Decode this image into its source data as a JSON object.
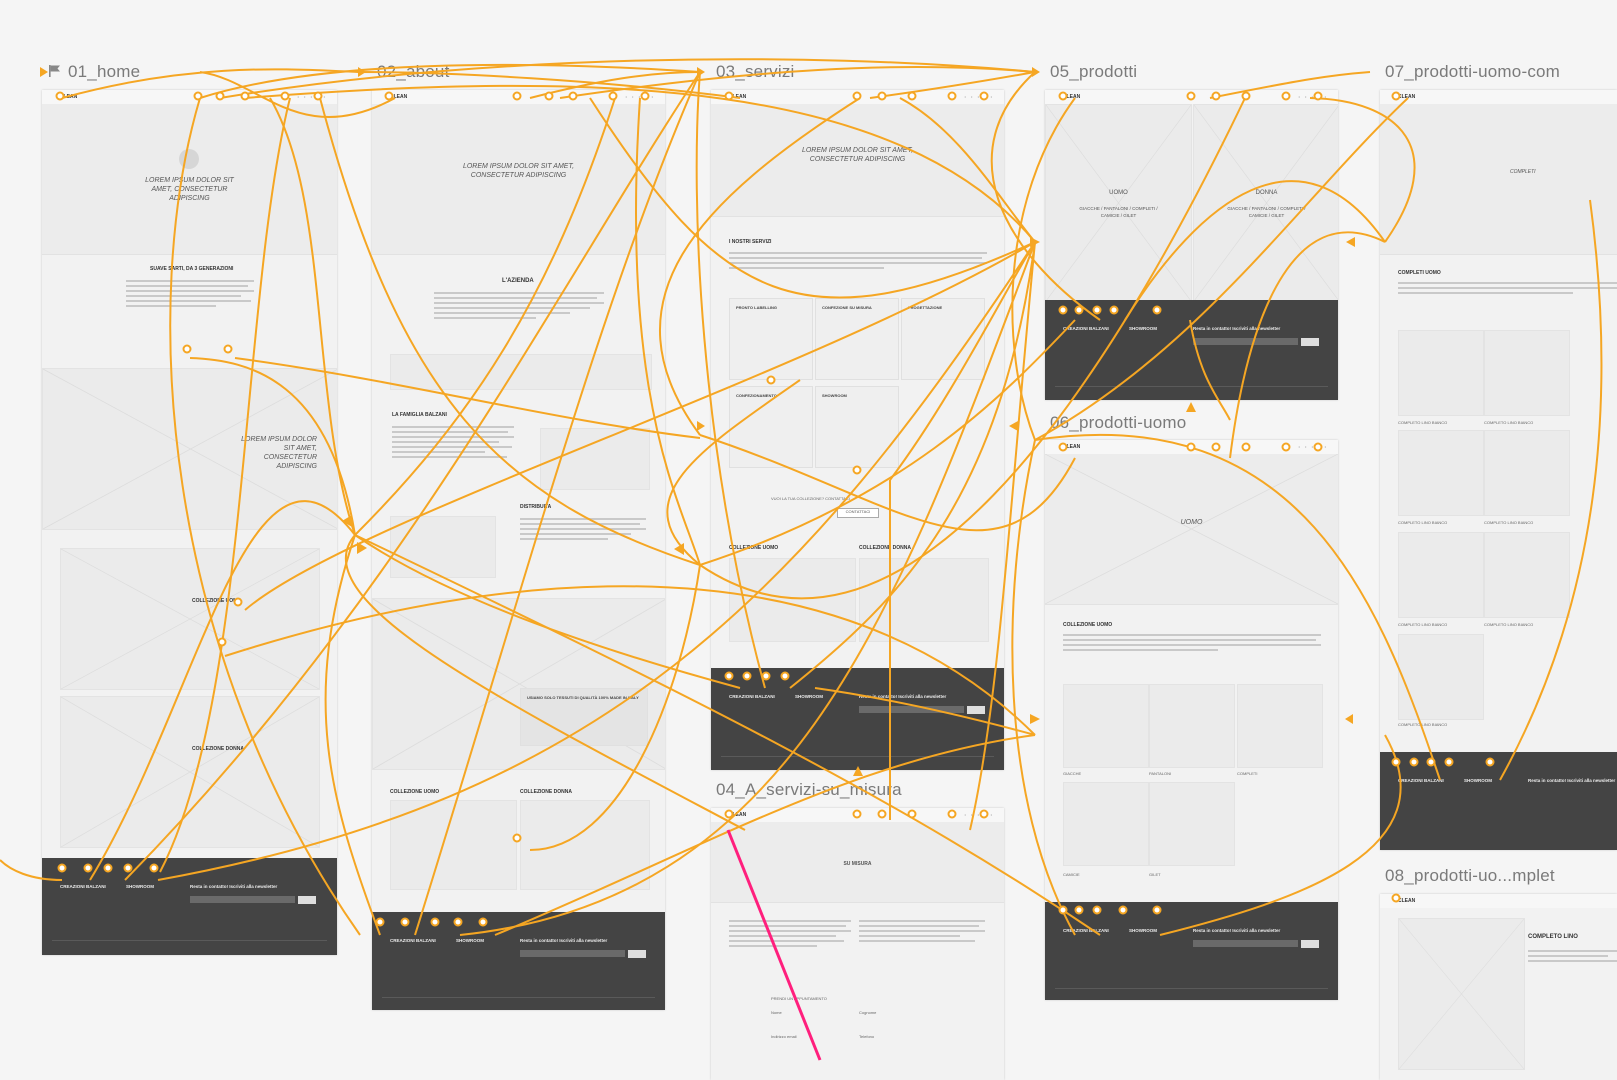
{
  "artboards": [
    {
      "id": "home",
      "title": "01_home",
      "flag": true
    },
    {
      "id": "about",
      "title": "02_about"
    },
    {
      "id": "servizi",
      "title": "03_servizi"
    },
    {
      "id": "prodotti",
      "title": "05_prodotti"
    },
    {
      "id": "prodotti_uomo_cut",
      "title": "07_prodotti-uomo-com"
    },
    {
      "id": "prodotti_uomo",
      "title": "06_prodotti-uomo"
    },
    {
      "id": "servizi_misura",
      "title": "04_A_servizi-su_misura"
    },
    {
      "id": "prodotti_completi",
      "title": "08_prodotti-uo...mplet"
    }
  ],
  "common": {
    "logo": "CLEAN",
    "lorem_hero": "LOREM IPSUM DOLOR SIT AMET, CONSECTETUR ADIPISCING",
    "lorem_hero_2": "LOREM IPSUM DOLOR SIT AMET, CONSECTETUR ADIPISCING",
    "footer": {
      "col1": "CREAZIONI BALZANI",
      "col2": "SHOWROOM",
      "col3": "Resta in contatto! Iscriviti alla newsletter"
    }
  },
  "home": {
    "section1_title": "SUAVE SARTI, DA 3 GENERAZIONI",
    "collezione_uomo": "COLLEZIONE UOMO",
    "collezione_donna": "COLLEZIONE DONNA"
  },
  "about": {
    "azienda": "L'AZIENDA",
    "famiglia": "LA FAMIGLIA BALZANI",
    "distribuita": "DISTRIBUITA",
    "tessuti": "USIAMO SOLO TESSUTI DI QUALITÀ 100% MADE IN ITALY",
    "collezione_uomo": "COLLEZIONE UOMO",
    "collezione_donna": "COLLEZIONE DONNA"
  },
  "servizi": {
    "nostri_servizi": "I NOSTRI SERVIZI",
    "cards": [
      "PRONTO LABELLING",
      "CONFEZIONE SU MISURA",
      "PROGETTAZIONE",
      "CONFEZIONAMENTO",
      "SHOWROOM"
    ],
    "cta_text": "VUOI LA TUA COLLEZIONE? CONTATTACI",
    "cta_button": "CONTATTACI",
    "collezione_uomo": "COLLEZIONE UOMO",
    "collezione_donna": "COLLEZIONE DONNA"
  },
  "prodotti": {
    "uomo": "UOMO",
    "uomo_sub": "GIACCHE / PANTALONI / COMPLETI / CAMICIE / GILET",
    "donna": "DONNA",
    "donna_sub": "GIACCHE / PANTALONI / COMPLETI / CAMICIE / GILET"
  },
  "prodotti_uomo": {
    "hero": "UOMO",
    "collezione": "COLLEZIONE UOMO",
    "labels": [
      "GIACCHE",
      "PANTALONI",
      "COMPLETI",
      "CAMICIE",
      "GILET"
    ]
  },
  "prodotti_uomo_cut": {
    "hero": "COMPLETI",
    "completi_title": "COMPLETI UOMO",
    "grid_label": "COMPLETO LINO BIANCO"
  },
  "servizi_misura": {
    "title": "SU MISURA",
    "form_title": "PRENDI UN APPUNTAMENTO",
    "fields": [
      "Nome",
      "Cognome",
      "Indirizzo email",
      "Telefono"
    ]
  },
  "prodotti_completi": {
    "title": "COMPLETO LINO"
  },
  "colors": {
    "link_wire": "#F5A623",
    "highlight_wire": "#FF1F7D",
    "footer": "#444444",
    "artboard": "#F2F2F2",
    "canvas": "#F5F5F5"
  }
}
